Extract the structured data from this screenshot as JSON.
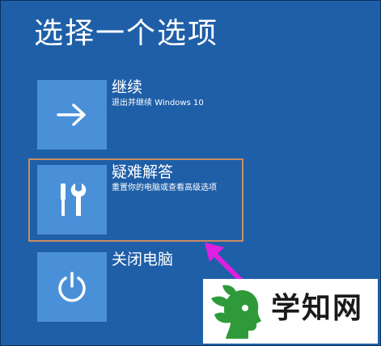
{
  "page": {
    "title": "选择一个选项"
  },
  "options": [
    {
      "title": "继续",
      "subtitle": "退出并继续 Windows 10",
      "icon": "arrow-right-icon"
    },
    {
      "title": "疑难解答",
      "subtitle": "重置你的电脑或查看高级选项",
      "icon": "tools-icon",
      "highlighted": true
    },
    {
      "title": "关闭电脑",
      "subtitle": "",
      "icon": "power-icon"
    }
  ],
  "annotation": {
    "arrow_color": "#e020e0",
    "highlight_color": "#c98c63"
  },
  "watermark": {
    "text": "学知网",
    "logo_color": "#2e9a3a"
  },
  "colors": {
    "background": "#1f5fa8",
    "tile": "#4a90d9",
    "text": "#ffffff"
  }
}
